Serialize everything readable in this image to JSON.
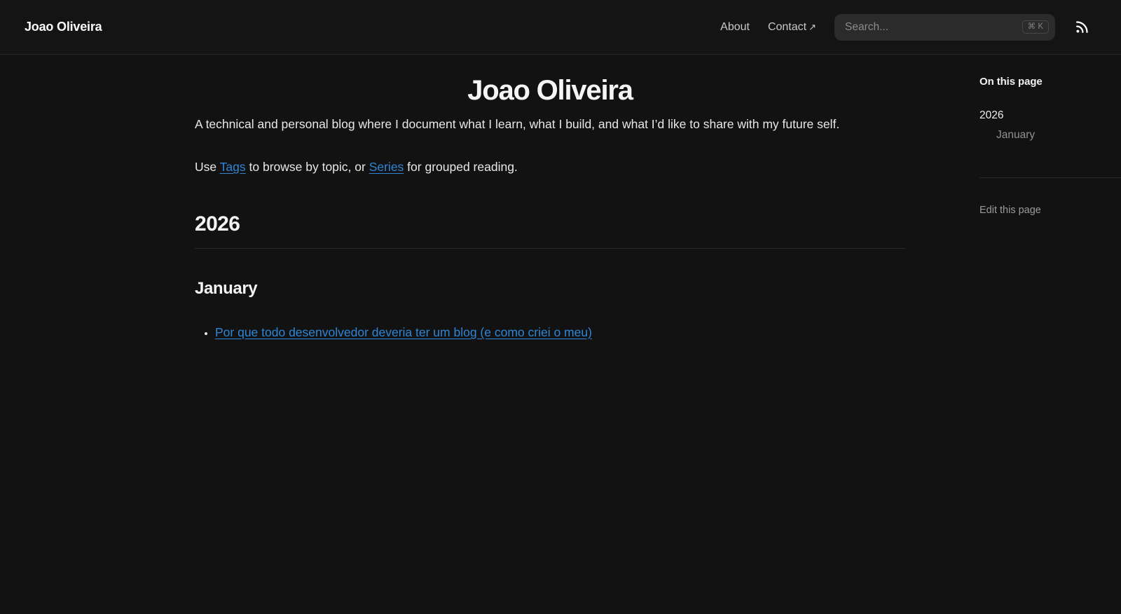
{
  "theme": {
    "background": "#121212",
    "navbar_background": "#141414",
    "link_color": "#2f86d6",
    "muted_text": "#8f8f8f",
    "search_background": "#2b2b2b"
  },
  "navbar": {
    "logo": "Joao Oliveira",
    "links": [
      {
        "label": "About",
        "external": false
      },
      {
        "label": "Contact",
        "external": true,
        "icon": "↗"
      }
    ],
    "search": {
      "placeholder": "Search...",
      "shortcut": "⌘ K"
    },
    "rss_icon": "rss-icon"
  },
  "content": {
    "title": "Joao Oliveira",
    "intro": "A technical and personal blog where I document what I learn, what I build, and what I’d like to share with my future self.",
    "browse": {
      "part1": "Use ",
      "tags_label": "Tags",
      "part2": " to browse by topic, or ",
      "series_label": "Series",
      "part3": " for grouped reading."
    },
    "year_heading": "2026",
    "month_heading": "January",
    "posts": [
      {
        "title": "Por que todo desenvolvedor deveria ter um blog (e como criei o meu)"
      }
    ]
  },
  "toc": {
    "title": "On this page",
    "items": [
      {
        "label": "2026",
        "level": 1
      },
      {
        "label": "January",
        "level": 2
      }
    ],
    "edit_label": "Edit this page"
  }
}
